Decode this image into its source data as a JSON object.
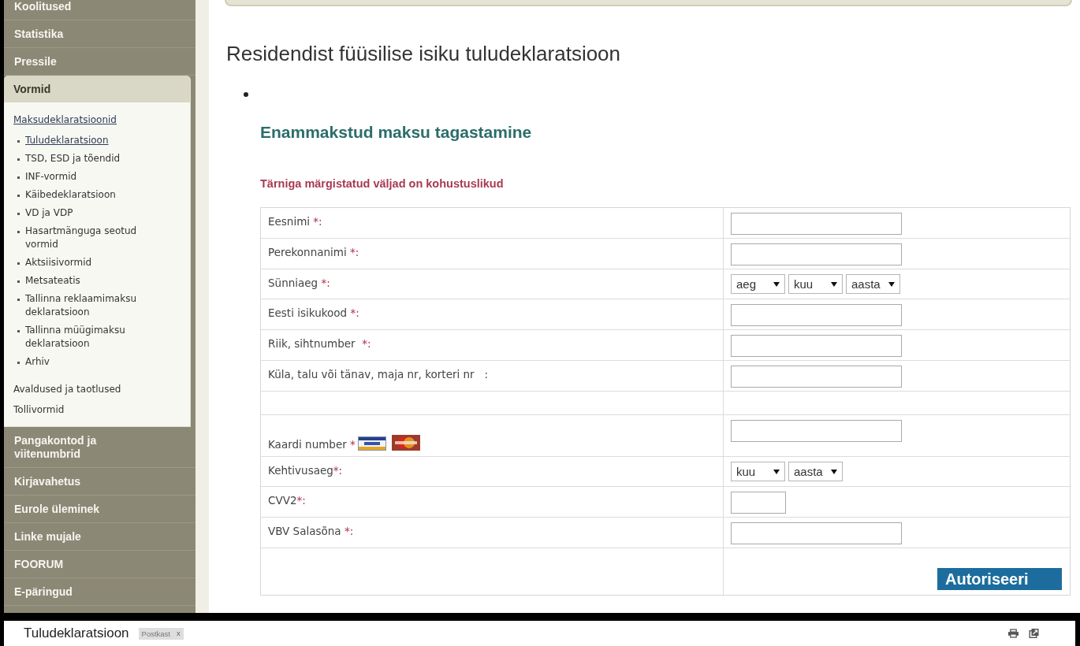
{
  "sidebar": {
    "items": [
      {
        "label": "Koolitused"
      },
      {
        "label": "Statistika"
      },
      {
        "label": "Pressile"
      },
      {
        "label": "Vormid",
        "expanded": true,
        "children": [
          {
            "label": "Maksudeklaratsioonid",
            "selected": true,
            "children": [
              {
                "label": "Tuludeklaratsioon",
                "selected": true
              },
              {
                "label": "TSD, ESD ja tõendid",
                "selected": false
              },
              {
                "label": "INF-vormid",
                "selected": false
              },
              {
                "label": "Käibedeklaratsioon",
                "selected": false
              },
              {
                "label": "VD ja VDP",
                "selected": false
              },
              {
                "label": "Hasartmänguga seotud vormid",
                "selected": false
              },
              {
                "label": "Aktsiisivormid",
                "selected": false
              },
              {
                "label": "Metsateatis",
                "selected": false
              },
              {
                "label": "Tallinna reklaamimaksu deklaratsioon",
                "selected": false
              },
              {
                "label": "Tallinna müügimaksu deklaratsioon",
                "selected": false
              },
              {
                "label": "Arhiv",
                "selected": false
              }
            ]
          },
          {
            "label": "Avaldused ja taotlused",
            "selected": false
          },
          {
            "label": "Tollivormid",
            "selected": false
          }
        ]
      },
      {
        "label": "Pangakontod ja viitenumbrid"
      },
      {
        "label": "Kirjavahetus"
      },
      {
        "label": "Eurole üleminek"
      },
      {
        "label": "Linke mujale"
      },
      {
        "label": "FOORUM"
      },
      {
        "label": "E-päringud"
      }
    ]
  },
  "page": {
    "title": "Residendist füüsilise isiku tuludeklaratsioon",
    "section_title": "Enammakstud maksu tagastamine",
    "required_note": "Tärniga märgistatud väljad on kohustuslikud"
  },
  "form": {
    "rows": [
      {
        "kind": "input",
        "label": "Eesnimi",
        "star": " *:"
      },
      {
        "kind": "input",
        "label": "Perekonnanimi",
        "star": " *:"
      },
      {
        "kind": "selects",
        "label": "Sünniaeg",
        "star": " *:",
        "selects": [
          "aeg",
          "kuu",
          "aasta"
        ]
      },
      {
        "kind": "input",
        "label": "Eesti isikukood",
        "star": " *:"
      },
      {
        "kind": "input",
        "label": "Riik, sihtnumber ",
        "star": " *:"
      },
      {
        "kind": "input",
        "label": "Küla, talu või tänav, maja nr, korteri nr   :"
      },
      {
        "kind": "blank"
      },
      {
        "kind": "card_input",
        "label": "Kaardi number",
        "star": " *"
      },
      {
        "kind": "selects",
        "label": "Kehtivusaeg",
        "star": "*:",
        "selects": [
          "kuu",
          "aasta"
        ]
      },
      {
        "kind": "short_input",
        "label": "CVV2",
        "star": "*:"
      },
      {
        "kind": "input",
        "label": "VBV Salasõna",
        "star": " *:"
      },
      {
        "kind": "submit",
        "button": "Autoriseeri"
      }
    ]
  },
  "mail_bar": {
    "subject": "Tuludeklaratsioon",
    "chip": {
      "label": "Postkast",
      "close": "x"
    }
  }
}
